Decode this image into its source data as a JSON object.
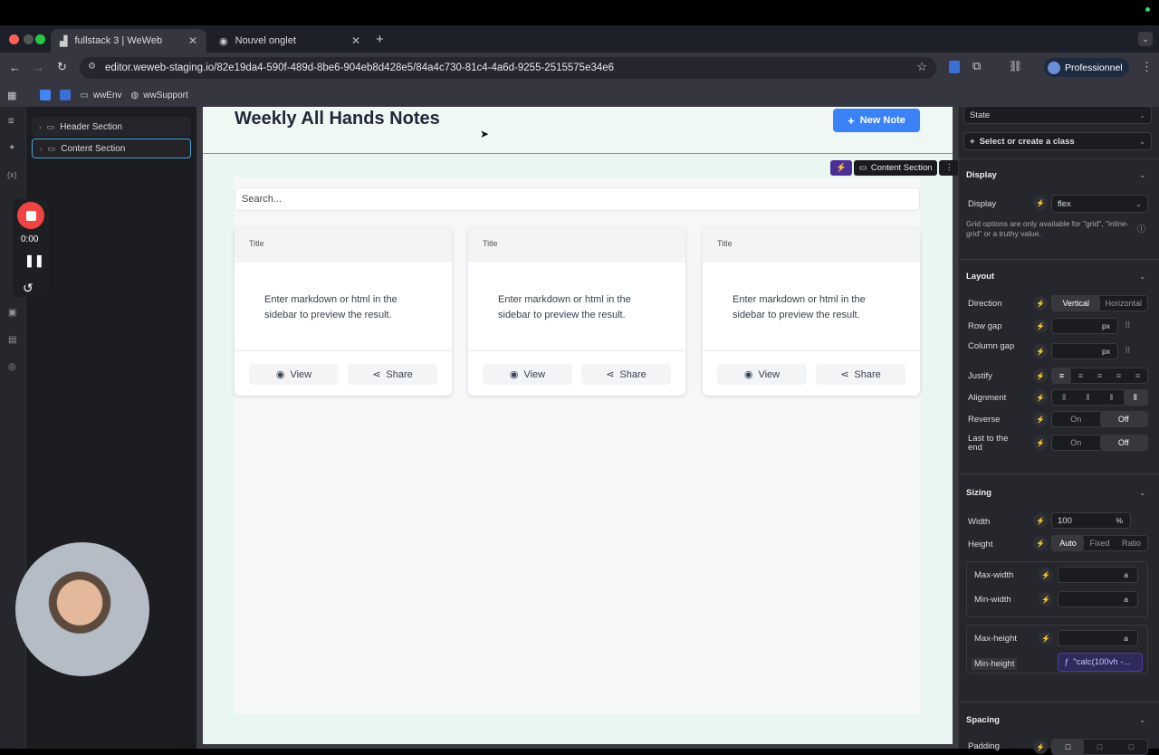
{
  "browser": {
    "tabs": [
      {
        "title": "fullstack 3 | WeWeb",
        "active": true
      },
      {
        "title": "Nouvel onglet",
        "active": false
      }
    ],
    "url": "editor.weweb-staging.io/82e19da4-590f-489d-8be6-904eb8d428e5/84a4c730-81c4-4a6d-9255-2515575e34e6",
    "profile": "Professionnel",
    "bookmarks": [
      "wwEnv",
      "wwSupport"
    ]
  },
  "tree": {
    "items": [
      "Header Section",
      "Content Section"
    ]
  },
  "recorder": {
    "time": "0:00"
  },
  "page": {
    "title": "Weekly All Hands Notes",
    "new_note": "New Note",
    "search_placeholder": "Search...",
    "selection_badge": "Content Section",
    "cards": [
      {
        "title": "Title",
        "body": "Enter markdown or html in the sidebar to preview the result.",
        "view": "View",
        "share": "Share"
      },
      {
        "title": "Title",
        "body": "Enter markdown or html in the sidebar to preview the result.",
        "view": "View",
        "share": "Share"
      },
      {
        "title": "Title",
        "body": "Enter markdown or html in the sidebar to preview the result.",
        "view": "View",
        "share": "Share"
      }
    ]
  },
  "panel": {
    "state": "State",
    "class_select": "Select or create a class",
    "display": {
      "heading": "Display",
      "label": "Display",
      "value": "flex",
      "note": "Grid options are only available for \"grid\", \"inline-grid\" or a truthy value."
    },
    "layout": {
      "heading": "Layout",
      "direction": "Direction",
      "dir_vertical": "Vertical",
      "dir_horizontal": "Horizontal",
      "row_gap": "Row gap",
      "column_gap": "Column gap",
      "unit": "px",
      "justify": "Justify",
      "alignment": "Alignment",
      "reverse": "Reverse",
      "last_to_end": "Last to the end",
      "on": "On",
      "off": "Off"
    },
    "sizing": {
      "heading": "Sizing",
      "width": "Width",
      "width_value": "100",
      "width_unit": "%",
      "height": "Height",
      "h_auto": "Auto",
      "h_fixed": "Fixed",
      "h_ratio": "Ratio",
      "max_width": "Max-width",
      "min_width": "Min-width",
      "max_height": "Max-height",
      "min_height": "Min-height",
      "min_height_value": "\"calc(100vh -...",
      "auto_unit": "a"
    },
    "spacing": {
      "heading": "Spacing",
      "padding": "Padding"
    }
  }
}
